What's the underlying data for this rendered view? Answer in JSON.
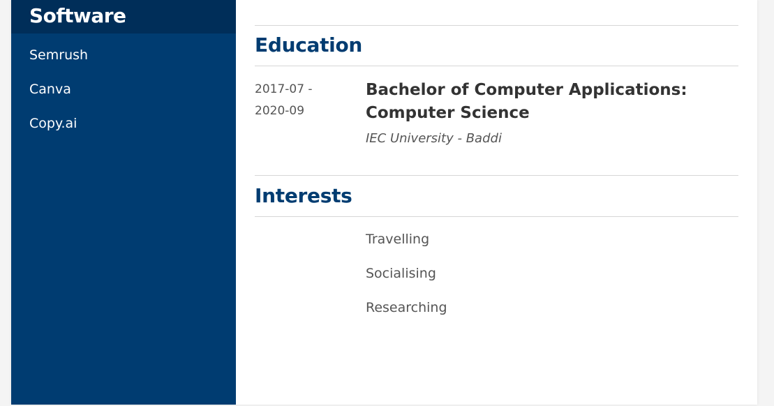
{
  "sidebar": {
    "heading": "Software",
    "items": [
      {
        "label": "Semrush"
      },
      {
        "label": "Canva"
      },
      {
        "label": "Copy.ai"
      }
    ]
  },
  "education": {
    "title": "Education",
    "entries": [
      {
        "start": "2017-07 -",
        "end": "2020-09",
        "degree_line1": "Bachelor of Computer Applications:",
        "degree_line2": "Computer Science",
        "school": "IEC University - Baddi"
      }
    ]
  },
  "interests": {
    "title": "Interests",
    "items": [
      {
        "label": "Travelling"
      },
      {
        "label": "Socialising"
      },
      {
        "label": "Researching"
      }
    ]
  },
  "colors": {
    "sidebar_bg": "#003c71",
    "sidebar_heading_bg": "#002e59",
    "heading_text": "#003c71",
    "body_text": "#555555"
  }
}
